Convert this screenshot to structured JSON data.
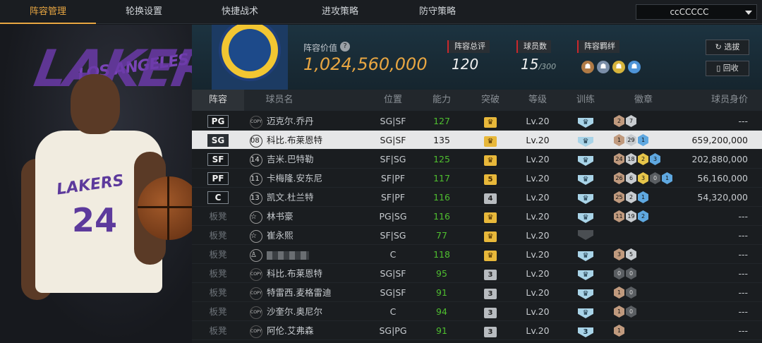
{
  "tabs": [
    "阵容管理",
    "轮换设置",
    "快捷战术",
    "进攻策略",
    "防守策略"
  ],
  "team_select": {
    "value": "ccCCCCC"
  },
  "summary": {
    "value_label": "阵容价值",
    "value": "1,024,560,000",
    "overall_label": "阵容总评",
    "overall": "120",
    "count_label": "球员数",
    "count": "15",
    "count_max": "/300",
    "bond_label": "阵容羁绊"
  },
  "buttons": {
    "pick": "选拔",
    "recycle": "回收"
  },
  "columns": [
    "阵容",
    "球员名",
    "位置",
    "能力",
    "突破",
    "等级",
    "训练",
    "徽章",
    "球员身价"
  ],
  "players": [
    {
      "slot": "PG",
      "icon": "copy",
      "num": "",
      "name": "迈克尔.乔丹",
      "pos": "SG|SF",
      "ability": "127",
      "break": "crown",
      "level": "Lv.20",
      "train": "crown",
      "badges": [
        [
          "2",
          "bronze"
        ],
        [
          "7",
          "silver"
        ]
      ],
      "worth": "---"
    },
    {
      "slot": "SG",
      "icon": "num",
      "num": "08",
      "name": "科比.布莱恩特",
      "pos": "SG|SF",
      "ability": "135",
      "break": "crown",
      "level": "Lv.20",
      "train": "crown",
      "badges": [
        [
          "1",
          "bronze"
        ],
        [
          "29",
          "silver"
        ],
        [
          "1",
          "blue"
        ]
      ],
      "worth": "659,200,000"
    },
    {
      "slot": "SF",
      "icon": "num",
      "num": "14",
      "name": "吉米.巴特勒",
      "pos": "SF|SG",
      "ability": "125",
      "break": "crown",
      "level": "Lv.20",
      "train": "crown",
      "badges": [
        [
          "24",
          "bronze"
        ],
        [
          "18",
          "silver"
        ],
        [
          "2",
          "gold"
        ],
        [
          "3",
          "blue"
        ]
      ],
      "worth": "202,880,000"
    },
    {
      "slot": "PF",
      "icon": "num",
      "num": "11",
      "name": "卡梅隆.安东尼",
      "pos": "SF|PF",
      "ability": "117",
      "break": "5",
      "level": "Lv.20",
      "train": "crown",
      "badges": [
        [
          "26",
          "bronze"
        ],
        [
          "6",
          "silver"
        ],
        [
          "3",
          "gold"
        ],
        [
          "0",
          "dark"
        ],
        [
          "1",
          "blue"
        ]
      ],
      "worth": "56,160,000"
    },
    {
      "slot": "C",
      "icon": "num",
      "num": "13",
      "name": "凯文.杜兰特",
      "pos": "SF|PF",
      "ability": "116",
      "break": "4",
      "level": "Lv.20",
      "train": "crown",
      "badges": [
        [
          "25",
          "bronze"
        ],
        [
          "2",
          "silver"
        ],
        [
          "1",
          "blue"
        ]
      ],
      "worth": "54,320,000"
    },
    {
      "slot": "板凳",
      "icon": "star",
      "num": "",
      "name": "林书豪",
      "pos": "PG|SG",
      "ability": "116",
      "break": "crown",
      "level": "Lv.20",
      "train": "crown",
      "badges": [
        [
          "11",
          "bronze"
        ],
        [
          "19",
          "silver"
        ],
        [
          "2",
          "blue"
        ]
      ],
      "worth": "---"
    },
    {
      "slot": "板凳",
      "icon": "star",
      "num": "",
      "name": "崔永熙",
      "pos": "SF|SG",
      "ability": "77",
      "break": "crown",
      "level": "Lv.20",
      "train": "dim",
      "badges": [],
      "worth": "---"
    },
    {
      "slot": "板凳",
      "icon": "person",
      "num": "",
      "name": "",
      "pos": "C",
      "ability": "118",
      "break": "crown",
      "level": "Lv.20",
      "train": "crown",
      "badges": [
        [
          "3",
          "bronze"
        ],
        [
          "5",
          "silver"
        ]
      ],
      "worth": "---"
    },
    {
      "slot": "板凳",
      "icon": "copy",
      "num": "",
      "name": "科比.布莱恩特",
      "pos": "SG|SF",
      "ability": "95",
      "break": "3",
      "level": "Lv.20",
      "train": "crown",
      "badges": [
        [
          "0",
          "dark"
        ],
        [
          "0",
          "dark"
        ]
      ],
      "worth": "---"
    },
    {
      "slot": "板凳",
      "icon": "copy",
      "num": "",
      "name": "特雷西.麦格雷迪",
      "pos": "SG|SF",
      "ability": "91",
      "break": "3",
      "level": "Lv.20",
      "train": "crown",
      "badges": [
        [
          "1",
          "bronze"
        ],
        [
          "0",
          "dark"
        ]
      ],
      "worth": "---"
    },
    {
      "slot": "板凳",
      "icon": "copy",
      "num": "",
      "name": "沙奎尔.奥尼尔",
      "pos": "C",
      "ability": "94",
      "break": "3",
      "level": "Lv.20",
      "train": "crown",
      "badges": [
        [
          "1",
          "bronze"
        ],
        [
          "0",
          "dark"
        ]
      ],
      "worth": "---"
    },
    {
      "slot": "板凳",
      "icon": "copy",
      "num": "",
      "name": "阿伦.艾弗森",
      "pos": "SG|PG",
      "ability": "91",
      "break": "3",
      "level": "Lv.20",
      "train": "3",
      "badges": [
        [
          "1",
          "bronze"
        ]
      ],
      "worth": "---"
    }
  ]
}
